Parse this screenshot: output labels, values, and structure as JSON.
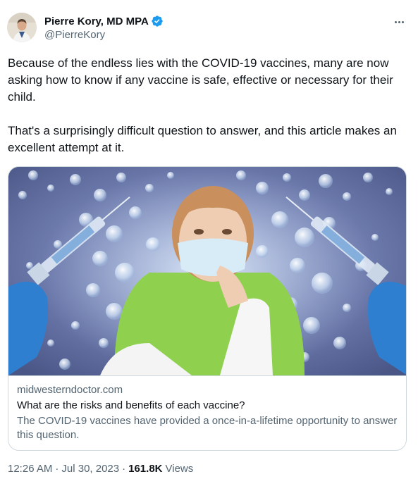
{
  "author": {
    "display_name": "Pierre Kory, MD MPA",
    "handle": "@PierreKory",
    "verified": true,
    "avatar_icon": "avatar-photo"
  },
  "menu_icon": "more-icon",
  "tweet": {
    "paragraphs": [
      "Because of the endless lies with the COVID-19 vaccines, many are now asking how to know if any vaccine is safe, effective or necessary for their child.",
      "That's a surprisingly difficult question to answer, and this article makes an excellent attempt at it."
    ]
  },
  "link_card": {
    "domain": "midwesterndoctor.com",
    "title": "What are the risks and benefits of each vaccine?",
    "description": "The COVID-19 vaccines have provided a once-in-a-lifetime opportunity to answer this question."
  },
  "meta": {
    "time": "12:26 AM",
    "date": "Jul 30, 2023",
    "views_count": "161.8K",
    "views_label": "Views"
  },
  "colors": {
    "verified": "#1d9bf0",
    "secondary_text": "#536471",
    "border": "#cfd9de"
  }
}
